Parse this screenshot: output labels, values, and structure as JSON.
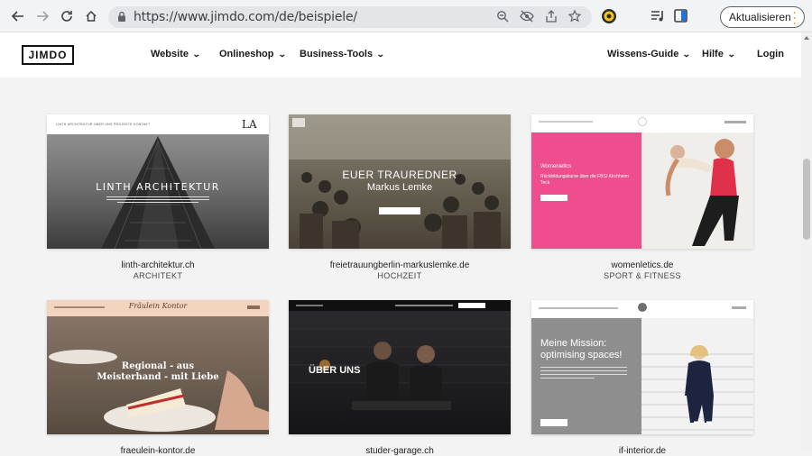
{
  "browser": {
    "url": "https://www.jimdo.com/de/beispiele/",
    "update_button": "Aktualisieren"
  },
  "site": {
    "logo": "JIMDO",
    "nav": {
      "website": "Website",
      "onlineshop": "Onlineshop",
      "business_tools": "Business-Tools",
      "wissens_guide": "Wissens-Guide",
      "hilfe": "Hilfe",
      "login": "Login"
    }
  },
  "examples": [
    {
      "title": "linth-architektur.ch",
      "category": "ARCHITEKT",
      "overlay": "LINTH ARCHITEKTUR",
      "badge": "LA",
      "nav_links": "LINTH ARCHITEKTUR   ÜBER UNS   PROJEKTE   KONTAKT"
    },
    {
      "title": "freietrauungberlin-markuslemke.de",
      "category": "HOCHZEIT",
      "overlay_line1": "EUER TRAUREDNER",
      "overlay_line2": "Markus Lemke"
    },
    {
      "title": "womenletics.de",
      "category": "SPORT & FITNESS",
      "brand": "Womenletics",
      "tagline": "Rückbildungskurse über die FBS/ Kirchheim Teck"
    },
    {
      "title": "fraeulein-kontor.de",
      "category": "",
      "script_title": "Fräulein Kontor",
      "overlay": "Regional - aus Meisterhand - mit Liebe"
    },
    {
      "title": "studer-garage.ch",
      "category": "",
      "overlay": "ÜBER UNS"
    },
    {
      "title": "if-interior.de",
      "category": "",
      "headline": "Meine Mission: optimising spaces!"
    }
  ],
  "colors": {
    "womenletics_pink": "#ee4d8e",
    "kontor_header": "#f2d4bf",
    "interior_grey": "#8e8e8e"
  }
}
